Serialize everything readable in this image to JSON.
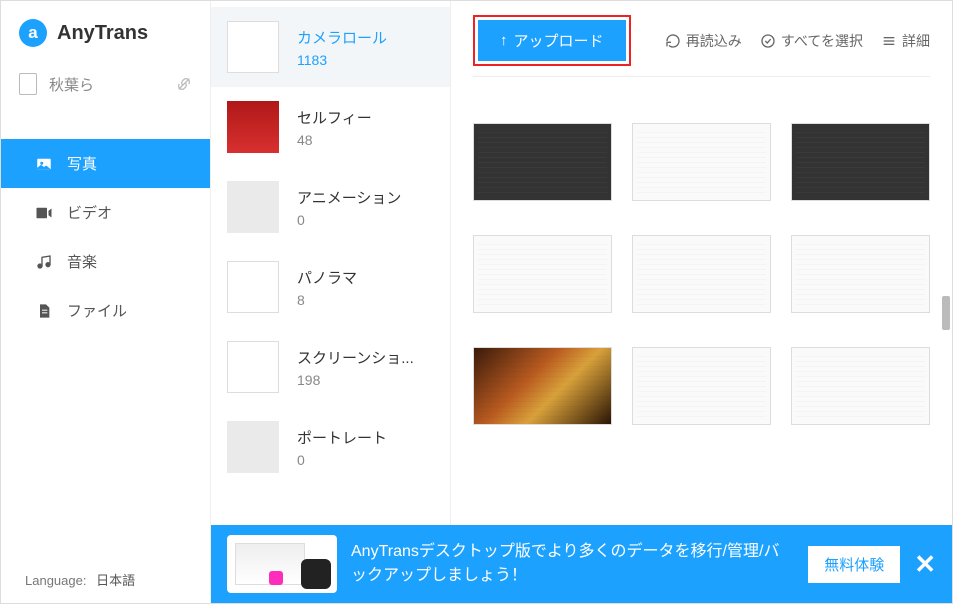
{
  "app": {
    "name": "AnyTrans"
  },
  "device": {
    "name": "秋葉ら"
  },
  "sidebar": {
    "items": [
      {
        "label": "写真",
        "icon": "image"
      },
      {
        "label": "ビデオ",
        "icon": "video"
      },
      {
        "label": "音楽",
        "icon": "music"
      },
      {
        "label": "ファイル",
        "icon": "file"
      }
    ],
    "activeIndex": 0
  },
  "language": {
    "label": "Language:",
    "value": "日本語"
  },
  "albums": [
    {
      "name": "カメラロール",
      "count": "1183",
      "thumb": "doc"
    },
    {
      "name": "セルフィー",
      "count": "48",
      "thumb": "red"
    },
    {
      "name": "アニメーション",
      "count": "0",
      "thumb": "gray"
    },
    {
      "name": "パノラマ",
      "count": "8",
      "thumb": "doc"
    },
    {
      "name": "スクリーンショ...",
      "count": "198",
      "thumb": "doc"
    },
    {
      "name": "ポートレート",
      "count": "0",
      "thumb": "gray"
    }
  ],
  "selectedAlbum": 0,
  "toolbar": {
    "upload": "アップロード",
    "reload": "再読込み",
    "selectAll": "すべてを選択",
    "details": "詳細"
  },
  "thumbs": [
    {
      "kind": "dark"
    },
    {
      "kind": "light"
    },
    {
      "kind": "dark"
    },
    {
      "kind": "light"
    },
    {
      "kind": "light"
    },
    {
      "kind": "light"
    },
    {
      "kind": "food"
    },
    {
      "kind": "light"
    },
    {
      "kind": "light"
    }
  ],
  "banner": {
    "text": "AnyTransデスクトップ版でより多くのデータを移行/管理/バックアップしましょう！",
    "cta": "無料体験"
  }
}
